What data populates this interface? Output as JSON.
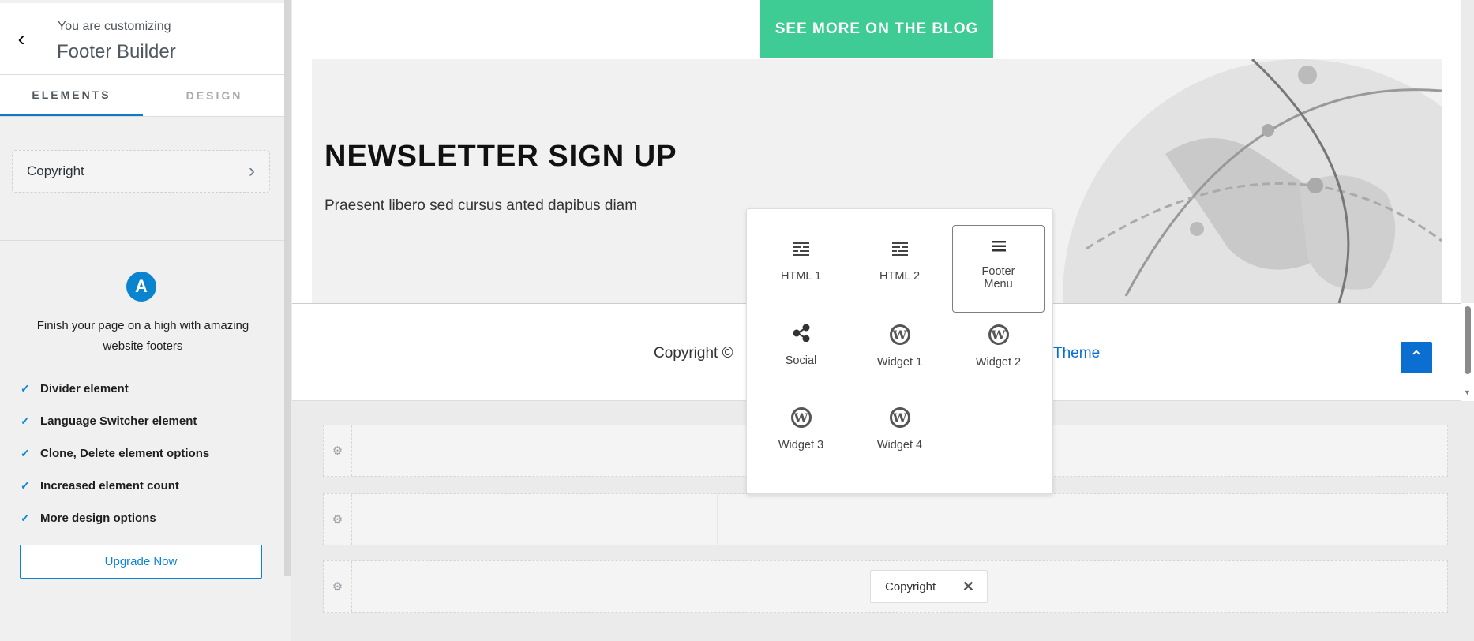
{
  "sidebar": {
    "back_icon": "chevron-left-icon",
    "subtitle": "You are customizing",
    "title": "Footer Builder",
    "tabs": [
      {
        "label": "ELEMENTS",
        "active": true
      },
      {
        "label": "DESIGN",
        "active": false
      }
    ],
    "item": {
      "label": "Copyright"
    },
    "promo": {
      "logo_letter": "A",
      "text": "Finish your page on a high with amazing website footers",
      "features": [
        "Divider element",
        "Language Switcher element",
        "Clone, Delete element options",
        "Increased element count",
        "More design options"
      ],
      "button": "Upgrade Now"
    }
  },
  "preview": {
    "blog_button": "SEE MORE ON THE BLOG",
    "newsletter_title": "NEWSLETTER SIGN UP",
    "newsletter_text": "Praesent libero sed cursus anted dapibus diam",
    "footer_text": "Copyright ©",
    "footer_link": "Theme",
    "scroll_top_icon": "chevron-up-icon"
  },
  "builder": {
    "chip_label": "Copyright",
    "chip_close": "✕",
    "gear_icon": "gear-icon"
  },
  "popup": {
    "items": [
      {
        "label": "HTML 1",
        "icon": "text-align-icon"
      },
      {
        "label": "HTML 2",
        "icon": "text-align-icon"
      },
      {
        "label": "Footer Menu",
        "icon": "menu-icon",
        "selected": true
      },
      {
        "label": "Social",
        "icon": "share-icon"
      },
      {
        "label": "Widget 1",
        "icon": "wordpress-icon"
      },
      {
        "label": "Widget 2",
        "icon": "wordpress-icon"
      },
      {
        "label": "Widget 3",
        "icon": "wordpress-icon"
      },
      {
        "label": "Widget 4",
        "icon": "wordpress-icon"
      }
    ]
  },
  "colors": {
    "accent": "#0b84d0",
    "blog_button": "#3ecb94",
    "link": "#0b6fd1"
  }
}
